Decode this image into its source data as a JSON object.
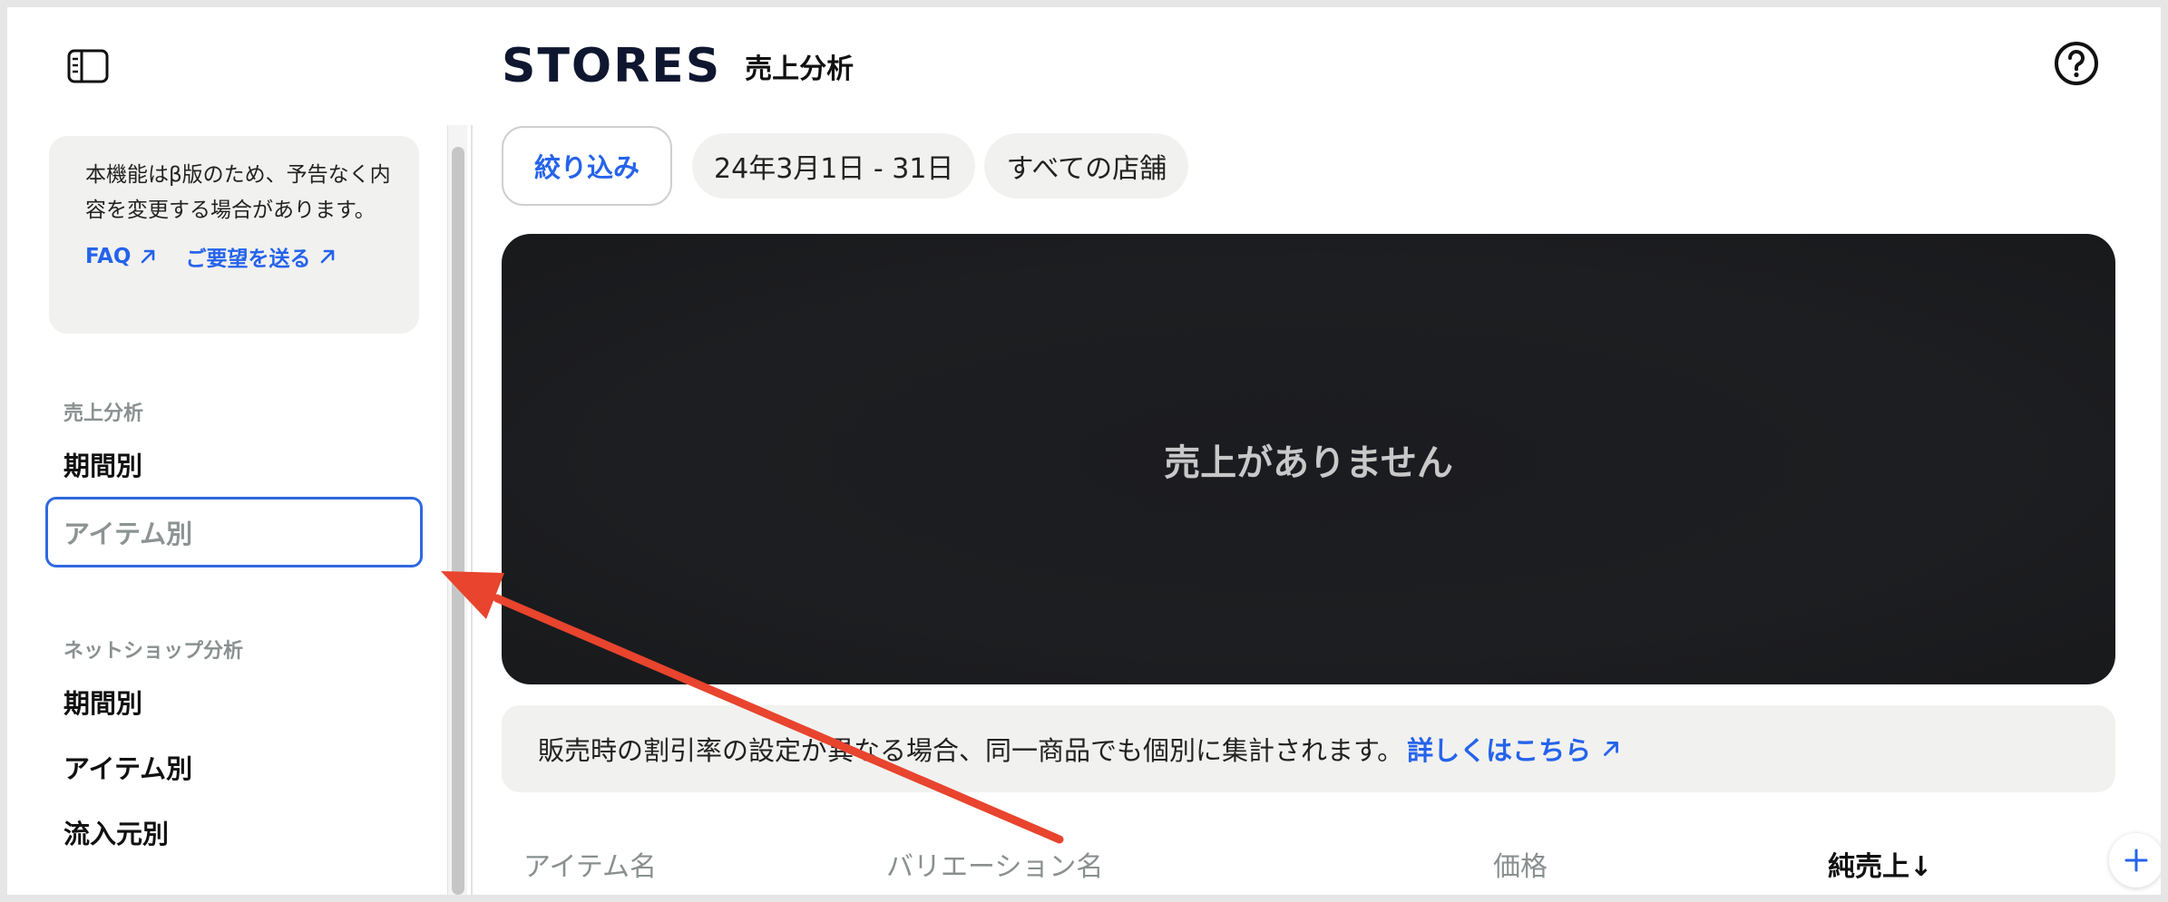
{
  "header": {
    "brand": "STORES",
    "title": "売上分析"
  },
  "sidebar": {
    "notice": {
      "text": "本機能はβ版のため、予告なく内容を変更する場合があります。",
      "links": [
        {
          "label": "FAQ"
        },
        {
          "label": "ご要望を送る"
        }
      ]
    },
    "sections": [
      {
        "label": "売上分析",
        "items": [
          {
            "label": "期間別",
            "active": false
          },
          {
            "label": "アイテム別",
            "active": true
          }
        ]
      },
      {
        "label": "ネットショップ分析",
        "items": [
          {
            "label": "期間別",
            "active": false
          },
          {
            "label": "アイテム別",
            "active": false
          },
          {
            "label": "流入元別",
            "active": false
          }
        ]
      }
    ]
  },
  "filters": {
    "button_label": "絞り込み",
    "date_range": "24年3月1日 - 31日",
    "store": "すべての店舗"
  },
  "chart": {
    "empty_message": "売上がありません"
  },
  "info": {
    "text": "販売時の割引率の設定が異なる場合、同一商品でも個別に集計されます。",
    "link_label": "詳しくはこちら"
  },
  "table": {
    "columns": [
      "アイテム名",
      "バリエーション名",
      "価格",
      "純売上↓"
    ]
  },
  "colors": {
    "accent": "#2563eb",
    "active_border": "#2f68e0",
    "annotation_arrow": "#e8442e",
    "panel_bg": "#1d1e21"
  }
}
